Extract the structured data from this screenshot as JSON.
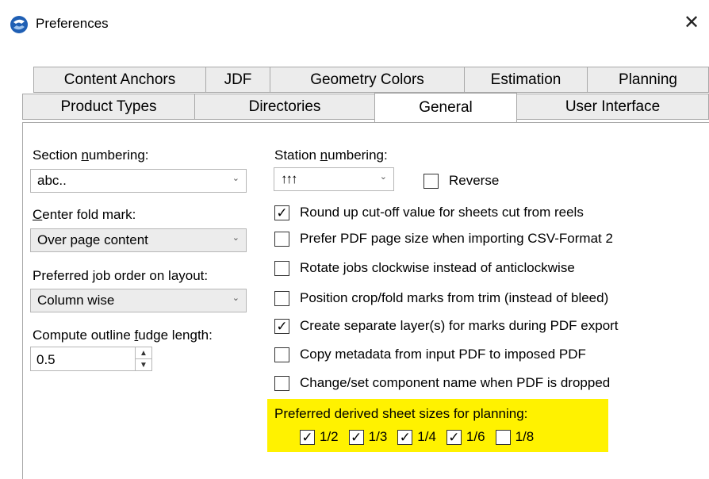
{
  "window": {
    "title": "Preferences",
    "close_label": "✕"
  },
  "tabs_row1": [
    {
      "label": "Content Anchors"
    },
    {
      "label": "JDF"
    },
    {
      "label": "Geometry Colors"
    },
    {
      "label": "Estimation"
    },
    {
      "label": "Planning"
    }
  ],
  "tabs_row2": [
    {
      "label": "Product Types"
    },
    {
      "label": "Directories"
    },
    {
      "label": "General",
      "active": true
    },
    {
      "label": "User Interface"
    }
  ],
  "left": {
    "section_numbering": {
      "label_pre": "Section ",
      "label_u": "n",
      "label_post": "umbering:",
      "value": "abc.."
    },
    "center_fold": {
      "label_u": "C",
      "label_post": "enter fold mark:",
      "value": "Over page content"
    },
    "job_order": {
      "label": "Preferred job order on layout:",
      "value": "Column wise"
    },
    "fudge": {
      "label_pre": "Compute outline ",
      "label_u": "f",
      "label_post": "udge length:",
      "value": "0.5"
    }
  },
  "right": {
    "station_numbering": {
      "label_pre": "Station ",
      "label_u": "n",
      "label_post": "umbering:",
      "value": "↑↑↑"
    },
    "reverse": {
      "label": "Reverse",
      "checked": false
    },
    "options": [
      {
        "label": "Round up cut-off value for sheets cut from reels",
        "checked": true
      },
      {
        "label": "Prefer PDF page size when importing CSV-Format 2",
        "checked": false
      },
      {
        "label": "Rotate jobs clockwise instead of anticlockwise",
        "checked": false
      },
      {
        "label": "Position crop/fold marks from trim (instead of bleed)",
        "checked": false
      },
      {
        "label": "Create separate layer(s) for marks during PDF export",
        "checked": true
      },
      {
        "label": "Copy metadata from input PDF to imposed PDF",
        "checked": false
      },
      {
        "label": "Change/set component name when PDF is dropped",
        "checked": false
      }
    ],
    "derived_sizes": {
      "label": "Preferred derived sheet sizes for planning:",
      "items": [
        {
          "label": "1/2",
          "checked": true
        },
        {
          "label": "1/3",
          "checked": true
        },
        {
          "label": "1/4",
          "checked": true
        },
        {
          "label": "1/6",
          "checked": true
        },
        {
          "label": "1/8",
          "checked": false
        }
      ]
    }
  },
  "icons": {
    "check": "✓",
    "chevron": "⌄",
    "spin_up": "▲",
    "spin_down": "▼"
  },
  "colors": {
    "highlight": "#fff200",
    "accent": "#1f5fb4"
  }
}
